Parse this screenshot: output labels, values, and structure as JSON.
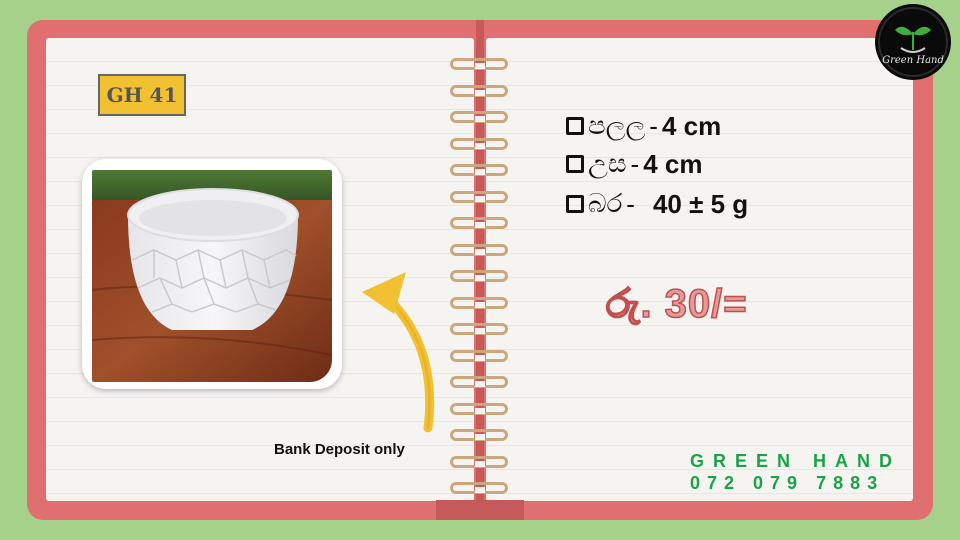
{
  "product": {
    "code": "GH 41",
    "specs": [
      {
        "label": "පලල",
        "separator": "-",
        "value": "4 cm"
      },
      {
        "label": "උස",
        "separator": "-",
        "value": "4 cm"
      },
      {
        "label": "බර",
        "separator": "-",
        "value": "40 ± 5 g"
      }
    ],
    "price": "රු. 30/="
  },
  "note": "Bank Deposit only",
  "brand": {
    "name": "GREEN HAND",
    "phone": "072 079 7883",
    "logo_text": "Green Hand"
  },
  "colors": {
    "background": "#a6d18a",
    "cover": "#e07070",
    "page": "#f6f4f1",
    "badge": "#f2c132",
    "arrow": "#f2c132",
    "brand_text": "#1aa24a",
    "price_text": "#c05050"
  },
  "icons": [
    "checkbox-icon",
    "curved-arrow-icon",
    "leaf-logo-icon",
    "spiral-ring-icon"
  ]
}
